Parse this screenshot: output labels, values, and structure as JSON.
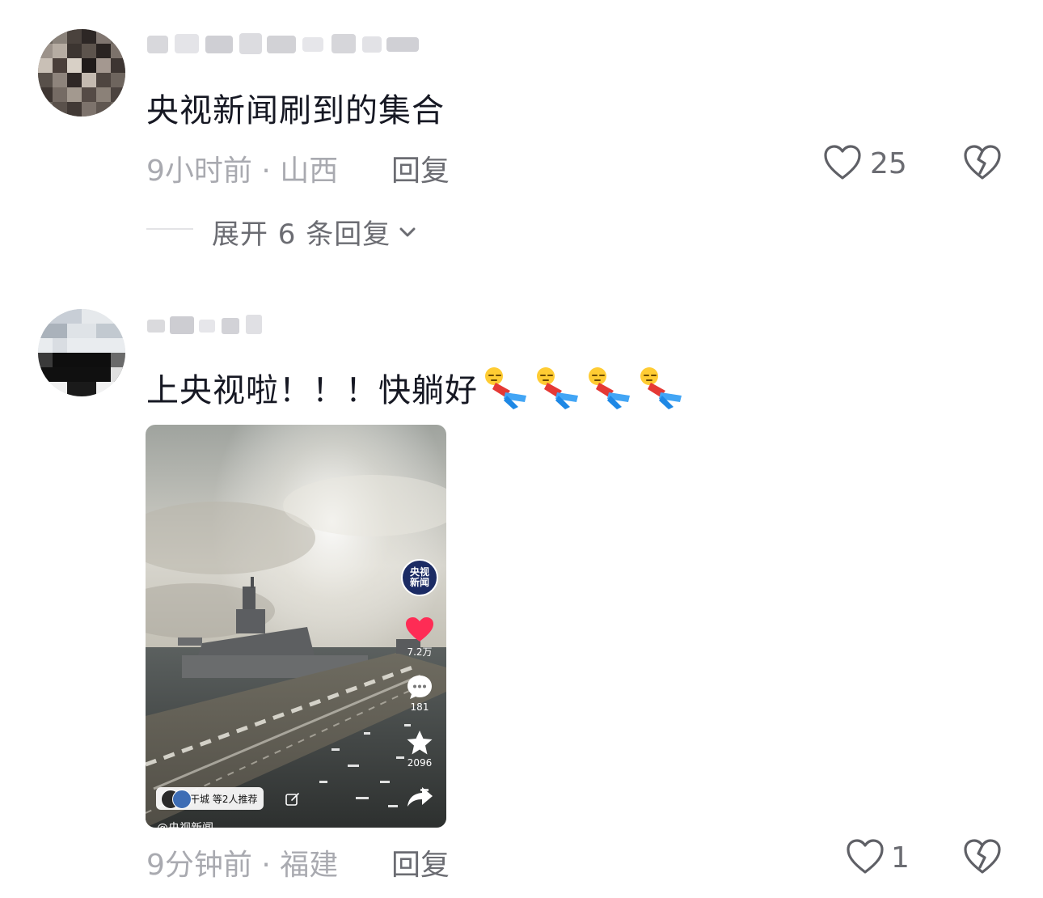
{
  "comments": [
    {
      "text": "央视新闻刷到的集合",
      "time_location": "9小时前 · 山西",
      "reply_label": "回复",
      "like_count": "25",
      "expand_replies_label": "展开 6 条回复"
    },
    {
      "text": "上央视啦！！！快躺好",
      "time_location": "9分钟前 · 福建",
      "reply_label": "回复",
      "like_count": "1",
      "video": {
        "channel_badge": "央视\n新闻",
        "likes": "7.2万",
        "comments": "181",
        "favorites": "2096",
        "recommend_label": "干城 等2人推荐",
        "author": "@央视新闻"
      }
    }
  ],
  "icons": {
    "like": "heart-outline-icon",
    "dislike": "broken-heart-icon",
    "expand": "chevron-down-icon",
    "emoji": "lying-down-emoji"
  },
  "colors": {
    "text_primary": "#161823",
    "text_secondary": "#a9aab0",
    "text_action": "#6b6c72",
    "video_like": "#fe2c55"
  }
}
